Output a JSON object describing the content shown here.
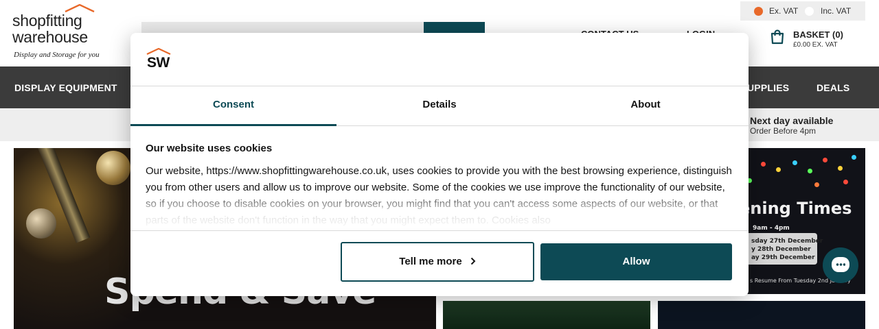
{
  "header": {
    "logo_line1": "shopfitting",
    "logo_line2": "warehouse",
    "logo_tagline": "Display and Storage for you",
    "contact_label": "CONTACT US",
    "login_label": "LOGIN",
    "vat": {
      "ex_label": "Ex. VAT",
      "inc_label": "Inc. VAT",
      "selected": "Ex. VAT"
    },
    "basket": {
      "title": "BASKET (0)",
      "subtitle": "£0.00 EX. VAT"
    }
  },
  "nav": {
    "items": [
      "DISPLAY EQUIPMENT",
      "UPPLIES",
      "DEALS"
    ]
  },
  "strip": {
    "title": "Next day available",
    "subtitle": "Order Before 4pm"
  },
  "banners": {
    "left_text": "Spend & Save",
    "right_title": "ening Times",
    "right_time": "9am - 4pm",
    "right_dates": [
      "sday 27th December",
      "y 28th December",
      "ay 29th December"
    ],
    "right_footer": "s Resume From Tuesday 2nd January"
  },
  "modal": {
    "logo_text": "SW",
    "tabs": [
      "Consent",
      "Details",
      "About"
    ],
    "active_tab": "Consent",
    "heading": "Our website uses cookies",
    "body": "Our website, https://www.shopfittingwarehouse.co.uk, uses cookies to provide you with the best browsing experience, distinguish you from other users and allow us to improve our website.  Some of the cookies we use improve the functionality of our website, so if you choose to disable cookies on your browser, you might find that you can't access some aspects of our website, or that parts of the website don't function in the way that you might expect them to. Cookies also",
    "btn_more_label": "Tell me more",
    "btn_allow_label": "Allow"
  },
  "colors": {
    "brand_teal": "#0d4a55",
    "brand_orange": "#e8692a",
    "nav_bg": "#3b3b3b"
  },
  "icons": [
    "roof-logo-icon",
    "basket-icon",
    "chevron-right-icon",
    "chat-icon"
  ]
}
